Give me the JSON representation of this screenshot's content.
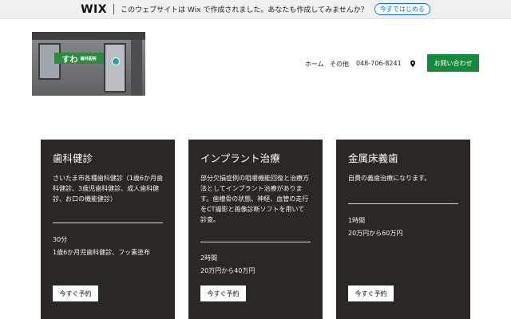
{
  "wix_banner": {
    "logo": "WIX",
    "message": "このウェブサイトは Wix で作成されました。あなたも作成してみませんか？",
    "cta": "今すではじめる"
  },
  "header": {
    "sign_text_large": "すわ",
    "sign_text_small": "歯科医院",
    "nav": {
      "home": "ホーム",
      "other": "その他",
      "phone": "048-706-8241"
    },
    "contact_button": "お問い合わせ"
  },
  "services": [
    {
      "title": "歯科健診",
      "description": "さいたま市各種歯科健診（1歳6か月歯科健診、3歳児歯科健診、成人歯科健診、お口の機能健診）",
      "duration": "30分",
      "price": "1歳6か月児歯科健診、フッ素塗布",
      "button": "今すぐ予約"
    },
    {
      "title": "インプラント治療",
      "description": "部分欠損症例の咀嚼機能回復と治療方法としてインプラント治療があります。歯槽骨の状態、神経、血管の走行をCT撮影と画像診断ソフトを用いて診査。",
      "duration": "2時間",
      "price": "20万円から40万円",
      "button": "今すぐ予約"
    },
    {
      "title": "金属床義歯",
      "description": "自費の義歯治療になります。",
      "duration": "1時間",
      "price": "20万円から60万円",
      "button": "今すぐ予約"
    }
  ],
  "colors": {
    "banner_bg": "#eef0f2",
    "wix_link": "#116dff",
    "contact_green": "#148a3b",
    "card_bg": "#2a2724"
  },
  "icons": {
    "location": "location-pin-icon"
  }
}
